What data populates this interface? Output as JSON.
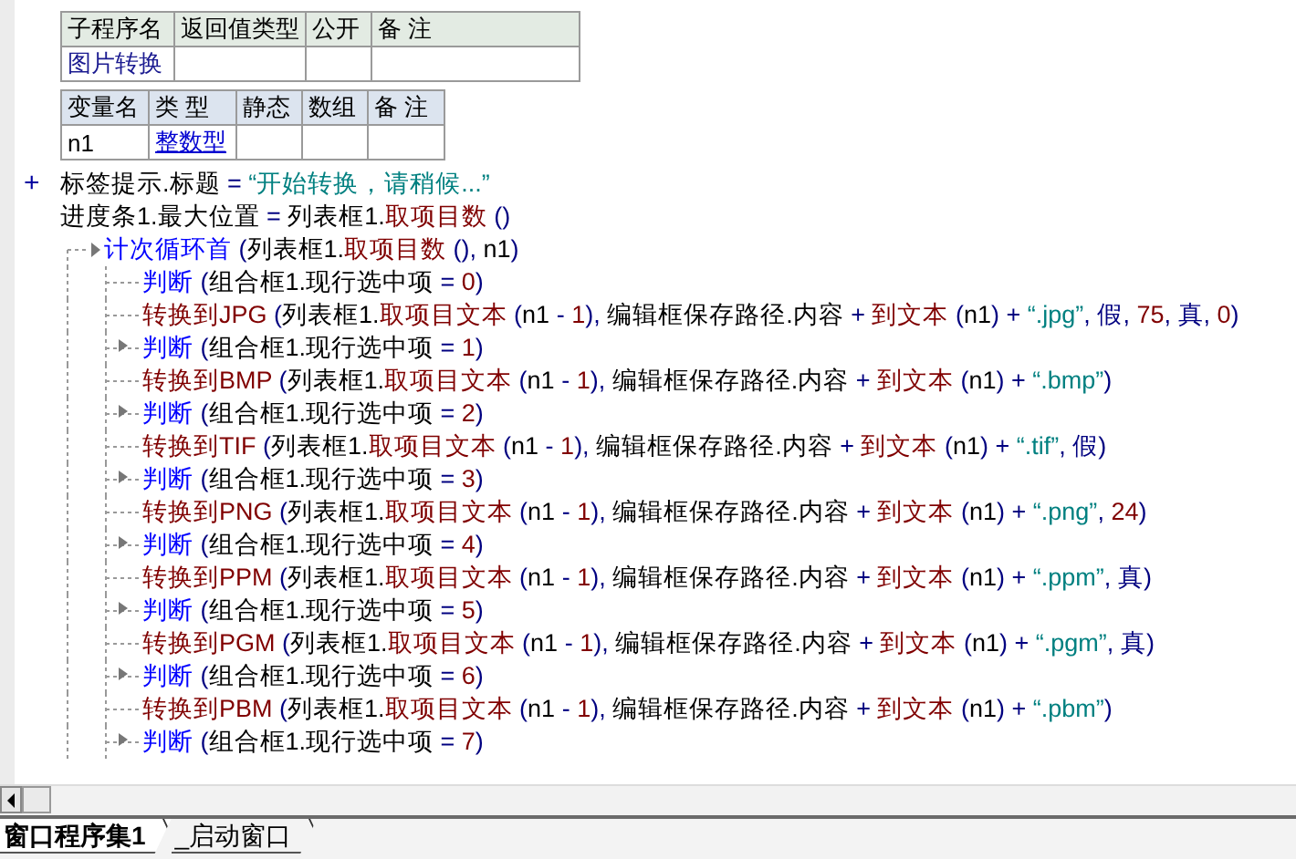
{
  "subroutine_table": {
    "columns": [
      "子程序名",
      "返回值类型",
      "公开",
      "备 注"
    ],
    "rows": [
      {
        "name": "图片转换"
      }
    ]
  },
  "variable_table": {
    "columns": [
      "变量名",
      "类 型",
      "静态",
      "数组",
      "备 注"
    ],
    "rows": [
      {
        "name": "n1",
        "type": "整数型"
      }
    ]
  },
  "code_lines": [
    {
      "kind": "statement",
      "marker": "+",
      "tokens": [
        {
          "kind": "text",
          "text": "标签提示.标题 "
        },
        {
          "kind": "op",
          "text": "= "
        },
        {
          "kind": "str",
          "text": "“开始转换，请稍候...”"
        }
      ]
    },
    {
      "kind": "statement",
      "tokens": [
        {
          "kind": "text",
          "text": "进度条1.最大位置 "
        },
        {
          "kind": "op",
          "text": "= "
        },
        {
          "kind": "text",
          "text": "列表框1."
        },
        {
          "kind": "call",
          "text": "取项目数"
        },
        {
          "kind": "op",
          "text": " ()"
        }
      ]
    },
    {
      "kind": "loop",
      "tokens": [
        {
          "kind": "kw",
          "text": "计次循环首"
        },
        {
          "kind": "op",
          "text": " ("
        },
        {
          "kind": "text",
          "text": "列表框1."
        },
        {
          "kind": "call",
          "text": "取项目数"
        },
        {
          "kind": "op",
          "text": " (), "
        },
        {
          "kind": "text",
          "text": "n1"
        },
        {
          "kind": "op",
          "text": ")"
        }
      ],
      "children": [
        {
          "kind": "statement",
          "branch_arrow": false,
          "tokens": [
            {
              "kind": "kw",
              "text": "判断"
            },
            {
              "kind": "op",
              "text": " ("
            },
            {
              "kind": "text",
              "text": "组合框1.现行选中项 "
            },
            {
              "kind": "op",
              "text": "= "
            },
            {
              "kind": "num",
              "text": "0"
            },
            {
              "kind": "op",
              "text": ")"
            }
          ]
        },
        {
          "kind": "statement",
          "branch_arrow": false,
          "tokens": [
            {
              "kind": "call",
              "text": "转换到JPG"
            },
            {
              "kind": "op",
              "text": " ("
            },
            {
              "kind": "text",
              "text": "列表框1."
            },
            {
              "kind": "call",
              "text": "取项目文本"
            },
            {
              "kind": "op",
              "text": " ("
            },
            {
              "kind": "text",
              "text": "n1 "
            },
            {
              "kind": "op",
              "text": "- "
            },
            {
              "kind": "num",
              "text": "1"
            },
            {
              "kind": "op",
              "text": "), "
            },
            {
              "kind": "text",
              "text": "编辑框保存路径.内容 "
            },
            {
              "kind": "op",
              "text": "+ "
            },
            {
              "kind": "call",
              "text": "到文本"
            },
            {
              "kind": "op",
              "text": " ("
            },
            {
              "kind": "text",
              "text": "n1"
            },
            {
              "kind": "op",
              "text": ") + "
            },
            {
              "kind": "str",
              "text": "“.jpg”"
            },
            {
              "kind": "op",
              "text": ", "
            },
            {
              "kind": "const",
              "text": "假"
            },
            {
              "kind": "op",
              "text": ", "
            },
            {
              "kind": "num",
              "text": "75"
            },
            {
              "kind": "op",
              "text": ", "
            },
            {
              "kind": "const",
              "text": "真"
            },
            {
              "kind": "op",
              "text": ", "
            },
            {
              "kind": "num",
              "text": "0"
            },
            {
              "kind": "op",
              "text": ")"
            }
          ]
        },
        {
          "kind": "statement",
          "branch_arrow": true,
          "tokens": [
            {
              "kind": "kw",
              "text": "判断"
            },
            {
              "kind": "op",
              "text": " ("
            },
            {
              "kind": "text",
              "text": "组合框1.现行选中项 "
            },
            {
              "kind": "op",
              "text": "= "
            },
            {
              "kind": "num",
              "text": "1"
            },
            {
              "kind": "op",
              "text": ")"
            }
          ]
        },
        {
          "kind": "statement",
          "branch_arrow": false,
          "tokens": [
            {
              "kind": "call",
              "text": "转换到BMP"
            },
            {
              "kind": "op",
              "text": " ("
            },
            {
              "kind": "text",
              "text": "列表框1."
            },
            {
              "kind": "call",
              "text": "取项目文本"
            },
            {
              "kind": "op",
              "text": " ("
            },
            {
              "kind": "text",
              "text": "n1 "
            },
            {
              "kind": "op",
              "text": "- "
            },
            {
              "kind": "num",
              "text": "1"
            },
            {
              "kind": "op",
              "text": "), "
            },
            {
              "kind": "text",
              "text": "编辑框保存路径.内容 "
            },
            {
              "kind": "op",
              "text": "+ "
            },
            {
              "kind": "call",
              "text": "到文本"
            },
            {
              "kind": "op",
              "text": " ("
            },
            {
              "kind": "text",
              "text": "n1"
            },
            {
              "kind": "op",
              "text": ") + "
            },
            {
              "kind": "str",
              "text": "“.bmp”"
            },
            {
              "kind": "op",
              "text": ")"
            }
          ]
        },
        {
          "kind": "statement",
          "branch_arrow": true,
          "tokens": [
            {
              "kind": "kw",
              "text": "判断"
            },
            {
              "kind": "op",
              "text": " ("
            },
            {
              "kind": "text",
              "text": "组合框1.现行选中项 "
            },
            {
              "kind": "op",
              "text": "= "
            },
            {
              "kind": "num",
              "text": "2"
            },
            {
              "kind": "op",
              "text": ")"
            }
          ]
        },
        {
          "kind": "statement",
          "branch_arrow": false,
          "tokens": [
            {
              "kind": "call",
              "text": "转换到TIF"
            },
            {
              "kind": "op",
              "text": " ("
            },
            {
              "kind": "text",
              "text": "列表框1."
            },
            {
              "kind": "call",
              "text": "取项目文本"
            },
            {
              "kind": "op",
              "text": " ("
            },
            {
              "kind": "text",
              "text": "n1 "
            },
            {
              "kind": "op",
              "text": "- "
            },
            {
              "kind": "num",
              "text": "1"
            },
            {
              "kind": "op",
              "text": "), "
            },
            {
              "kind": "text",
              "text": "编辑框保存路径.内容 "
            },
            {
              "kind": "op",
              "text": "+ "
            },
            {
              "kind": "call",
              "text": "到文本"
            },
            {
              "kind": "op",
              "text": " ("
            },
            {
              "kind": "text",
              "text": "n1"
            },
            {
              "kind": "op",
              "text": ") + "
            },
            {
              "kind": "str",
              "text": "“.tif”"
            },
            {
              "kind": "op",
              "text": ", "
            },
            {
              "kind": "const",
              "text": "假"
            },
            {
              "kind": "op",
              "text": ")"
            }
          ]
        },
        {
          "kind": "statement",
          "branch_arrow": true,
          "tokens": [
            {
              "kind": "kw",
              "text": "判断"
            },
            {
              "kind": "op",
              "text": " ("
            },
            {
              "kind": "text",
              "text": "组合框1.现行选中项 "
            },
            {
              "kind": "op",
              "text": "= "
            },
            {
              "kind": "num",
              "text": "3"
            },
            {
              "kind": "op",
              "text": ")"
            }
          ]
        },
        {
          "kind": "statement",
          "branch_arrow": false,
          "tokens": [
            {
              "kind": "call",
              "text": "转换到PNG"
            },
            {
              "kind": "op",
              "text": " ("
            },
            {
              "kind": "text",
              "text": "列表框1."
            },
            {
              "kind": "call",
              "text": "取项目文本"
            },
            {
              "kind": "op",
              "text": " ("
            },
            {
              "kind": "text",
              "text": "n1 "
            },
            {
              "kind": "op",
              "text": "- "
            },
            {
              "kind": "num",
              "text": "1"
            },
            {
              "kind": "op",
              "text": "), "
            },
            {
              "kind": "text",
              "text": "编辑框保存路径.内容 "
            },
            {
              "kind": "op",
              "text": "+ "
            },
            {
              "kind": "call",
              "text": "到文本"
            },
            {
              "kind": "op",
              "text": " ("
            },
            {
              "kind": "text",
              "text": "n1"
            },
            {
              "kind": "op",
              "text": ") + "
            },
            {
              "kind": "str",
              "text": "“.png”"
            },
            {
              "kind": "op",
              "text": ", "
            },
            {
              "kind": "num",
              "text": "24"
            },
            {
              "kind": "op",
              "text": ")"
            }
          ]
        },
        {
          "kind": "statement",
          "branch_arrow": true,
          "tokens": [
            {
              "kind": "kw",
              "text": "判断"
            },
            {
              "kind": "op",
              "text": " ("
            },
            {
              "kind": "text",
              "text": "组合框1.现行选中项 "
            },
            {
              "kind": "op",
              "text": "= "
            },
            {
              "kind": "num",
              "text": "4"
            },
            {
              "kind": "op",
              "text": ")"
            }
          ]
        },
        {
          "kind": "statement",
          "branch_arrow": false,
          "tokens": [
            {
              "kind": "call",
              "text": "转换到PPM"
            },
            {
              "kind": "op",
              "text": " ("
            },
            {
              "kind": "text",
              "text": "列表框1."
            },
            {
              "kind": "call",
              "text": "取项目文本"
            },
            {
              "kind": "op",
              "text": " ("
            },
            {
              "kind": "text",
              "text": "n1 "
            },
            {
              "kind": "op",
              "text": "- "
            },
            {
              "kind": "num",
              "text": "1"
            },
            {
              "kind": "op",
              "text": "), "
            },
            {
              "kind": "text",
              "text": "编辑框保存路径.内容 "
            },
            {
              "kind": "op",
              "text": "+ "
            },
            {
              "kind": "call",
              "text": "到文本"
            },
            {
              "kind": "op",
              "text": " ("
            },
            {
              "kind": "text",
              "text": "n1"
            },
            {
              "kind": "op",
              "text": ") + "
            },
            {
              "kind": "str",
              "text": "“.ppm”"
            },
            {
              "kind": "op",
              "text": ", "
            },
            {
              "kind": "const",
              "text": "真"
            },
            {
              "kind": "op",
              "text": ")"
            }
          ]
        },
        {
          "kind": "statement",
          "branch_arrow": true,
          "tokens": [
            {
              "kind": "kw",
              "text": "判断"
            },
            {
              "kind": "op",
              "text": " ("
            },
            {
              "kind": "text",
              "text": "组合框1.现行选中项 "
            },
            {
              "kind": "op",
              "text": "= "
            },
            {
              "kind": "num",
              "text": "5"
            },
            {
              "kind": "op",
              "text": ")"
            }
          ]
        },
        {
          "kind": "statement",
          "branch_arrow": false,
          "tokens": [
            {
              "kind": "call",
              "text": "转换到PGM"
            },
            {
              "kind": "op",
              "text": " ("
            },
            {
              "kind": "text",
              "text": "列表框1."
            },
            {
              "kind": "call",
              "text": "取项目文本"
            },
            {
              "kind": "op",
              "text": " ("
            },
            {
              "kind": "text",
              "text": "n1 "
            },
            {
              "kind": "op",
              "text": "- "
            },
            {
              "kind": "num",
              "text": "1"
            },
            {
              "kind": "op",
              "text": "), "
            },
            {
              "kind": "text",
              "text": "编辑框保存路径.内容 "
            },
            {
              "kind": "op",
              "text": "+ "
            },
            {
              "kind": "call",
              "text": "到文本"
            },
            {
              "kind": "op",
              "text": " ("
            },
            {
              "kind": "text",
              "text": "n1"
            },
            {
              "kind": "op",
              "text": ") + "
            },
            {
              "kind": "str",
              "text": "“.pgm”"
            },
            {
              "kind": "op",
              "text": ", "
            },
            {
              "kind": "const",
              "text": "真"
            },
            {
              "kind": "op",
              "text": ")"
            }
          ]
        },
        {
          "kind": "statement",
          "branch_arrow": true,
          "tokens": [
            {
              "kind": "kw",
              "text": "判断"
            },
            {
              "kind": "op",
              "text": " ("
            },
            {
              "kind": "text",
              "text": "组合框1.现行选中项 "
            },
            {
              "kind": "op",
              "text": "= "
            },
            {
              "kind": "num",
              "text": "6"
            },
            {
              "kind": "op",
              "text": ")"
            }
          ]
        },
        {
          "kind": "statement",
          "branch_arrow": false,
          "tokens": [
            {
              "kind": "call",
              "text": "转换到PBM"
            },
            {
              "kind": "op",
              "text": " ("
            },
            {
              "kind": "text",
              "text": "列表框1."
            },
            {
              "kind": "call",
              "text": "取项目文本"
            },
            {
              "kind": "op",
              "text": " ("
            },
            {
              "kind": "text",
              "text": "n1 "
            },
            {
              "kind": "op",
              "text": "- "
            },
            {
              "kind": "num",
              "text": "1"
            },
            {
              "kind": "op",
              "text": "), "
            },
            {
              "kind": "text",
              "text": "编辑框保存路径.内容 "
            },
            {
              "kind": "op",
              "text": "+ "
            },
            {
              "kind": "call",
              "text": "到文本"
            },
            {
              "kind": "op",
              "text": " ("
            },
            {
              "kind": "text",
              "text": "n1"
            },
            {
              "kind": "op",
              "text": ") + "
            },
            {
              "kind": "str",
              "text": "“.pbm”"
            },
            {
              "kind": "op",
              "text": ")"
            }
          ]
        },
        {
          "kind": "statement",
          "branch_arrow": true,
          "tokens": [
            {
              "kind": "kw",
              "text": "判断"
            },
            {
              "kind": "op",
              "text": " ("
            },
            {
              "kind": "text",
              "text": "组合框1.现行选中项 "
            },
            {
              "kind": "op",
              "text": "= "
            },
            {
              "kind": "num",
              "text": "7"
            },
            {
              "kind": "op",
              "text": ")"
            }
          ]
        }
      ]
    }
  ],
  "tabs": [
    {
      "label": "窗口程序集1",
      "selected": true
    },
    {
      "label": "_启动窗口",
      "selected": false
    }
  ]
}
